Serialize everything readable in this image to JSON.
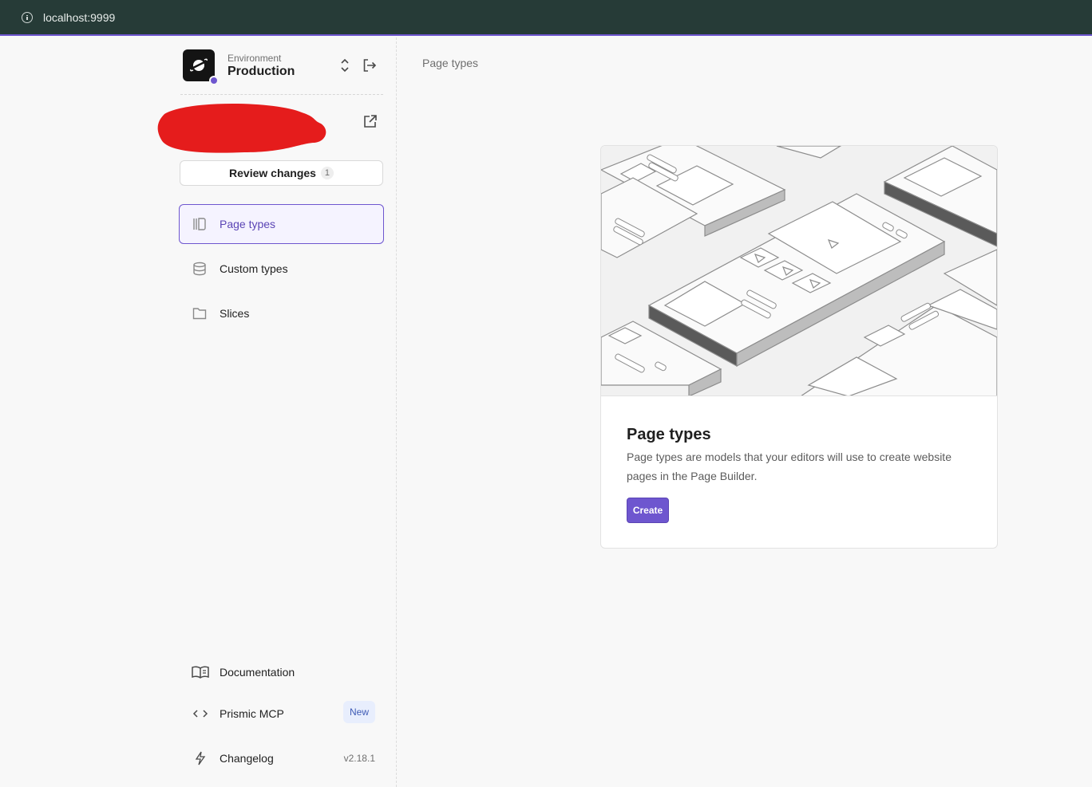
{
  "browser": {
    "url": "localhost:9999"
  },
  "environment": {
    "label": "Environment",
    "name": "Production"
  },
  "review": {
    "label": "Review changes",
    "count": "1"
  },
  "nav": {
    "page_types": "Page types",
    "custom_types": "Custom types",
    "slices": "Slices"
  },
  "footer": {
    "documentation": "Documentation",
    "mcp": "Prismic MCP",
    "mcp_badge": "New",
    "changelog": "Changelog",
    "version": "v2.18.1"
  },
  "main": {
    "breadcrumb": "Page types",
    "card": {
      "title": "Page types",
      "description": "Page types are models that your editors will use to create website pages in the Page Builder.",
      "create_label": "Create"
    }
  },
  "colors": {
    "accent": "#6e56cf",
    "browser_bar": "#263b37",
    "redaction": "#e51c1c"
  }
}
